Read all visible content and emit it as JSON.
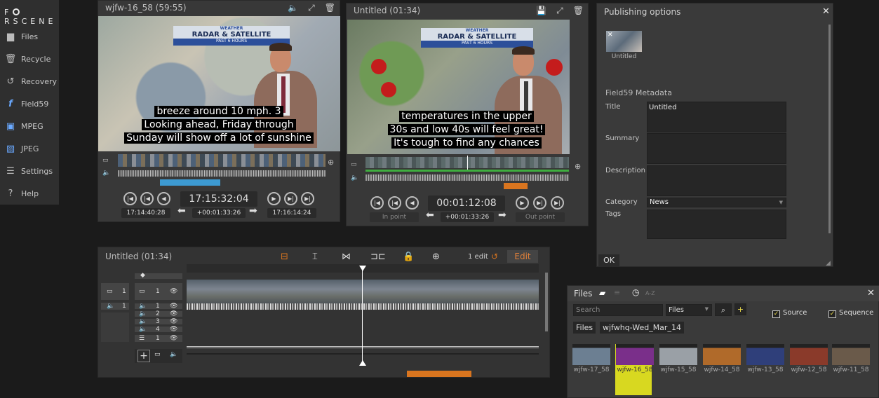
{
  "app": {
    "logo_left": "F",
    "logo_right": "RSCENE"
  },
  "sidebar": {
    "items": [
      {
        "label": "Files",
        "icon": "folder-icon"
      },
      {
        "label": "Recycle",
        "icon": "trash-icon"
      },
      {
        "label": "Recovery",
        "icon": "history-icon"
      },
      {
        "label": "Field59",
        "icon": "field59-icon"
      },
      {
        "label": "MPEG",
        "icon": "film-icon"
      },
      {
        "label": "JPEG",
        "icon": "image-icon"
      },
      {
        "label": "Settings",
        "icon": "settings-icon"
      },
      {
        "label": "Help",
        "icon": "help-icon"
      }
    ]
  },
  "source_viewer": {
    "title": "wjfw-16_58 (59:55)",
    "banner_brand": "WEATHER",
    "banner_title": "RADAR & SATELLITE",
    "banner_sub": "PAST 6 HOURS",
    "caption": [
      "breeze around 10 mph. 3",
      "Looking ahead, Friday through",
      "Sunday will show off a lot of sunshine"
    ],
    "timecode": "17:15:32:04",
    "in_time": "17:14:40:28",
    "duration": "+00:01:33:26",
    "out_time": "17:16:14:24"
  },
  "program_viewer": {
    "title": "Untitled (01:34)",
    "banner_brand": "WEATHER",
    "banner_title": "RADAR & SATELLITE",
    "banner_sub": "PAST 6 HOURS",
    "caption": [
      "temperatures in the upper",
      "30s and low 40s will feel great!",
      "It's tough to find any chances"
    ],
    "timecode": "00:01:12:08",
    "in_label": "In point",
    "duration": "+00:01:33:26",
    "out_label": "Out point"
  },
  "timeline": {
    "title": "Untitled (01:34)",
    "edit_count": "1 edit",
    "edit_label": "Edit",
    "track_headers": {
      "left_video": "1",
      "left_audio": "1",
      "video": "1",
      "audio": [
        "1",
        "2",
        "3",
        "4"
      ],
      "subtitle": "1"
    }
  },
  "publishing": {
    "title": "Publishing options",
    "thumb_label": "Untitled",
    "section": "Field59 Metadata",
    "fields": {
      "title_label": "Title",
      "title_value": "Untitled",
      "summary_label": "Summary",
      "description_label": "Description",
      "category_label": "Category",
      "category_value": "News",
      "tags_label": "Tags"
    },
    "ok_label": "OK"
  },
  "files": {
    "title": "Files",
    "sort_label": "A-Z",
    "search_placeholder": "Search",
    "files_select": "Files",
    "source_label": "Source",
    "sequence_label": "Sequence",
    "breadcrumb_root": "Files",
    "breadcrumb_folder": "wjfwhq-Wed_Mar_14",
    "thumbs": [
      {
        "label": "wjfw-17_58",
        "color": "#6c7f92"
      },
      {
        "label": "wjfw-16_58",
        "color": "#7a2f8a"
      },
      {
        "label": "wjfw-15_58",
        "color": "#9aa0a6"
      },
      {
        "label": "wjfw-14_58",
        "color": "#b06a2a"
      },
      {
        "label": "wjfw-13_58",
        "color": "#2f3f7a"
      },
      {
        "label": "wjfw-12_58",
        "color": "#8a3a2a"
      },
      {
        "label": "wjfw-11_58",
        "color": "#6a5a4a"
      }
    ]
  },
  "colors": {
    "accent_orange": "#d9751f",
    "selected_yellow": "#d8d820",
    "background": "#1b1b1b"
  }
}
